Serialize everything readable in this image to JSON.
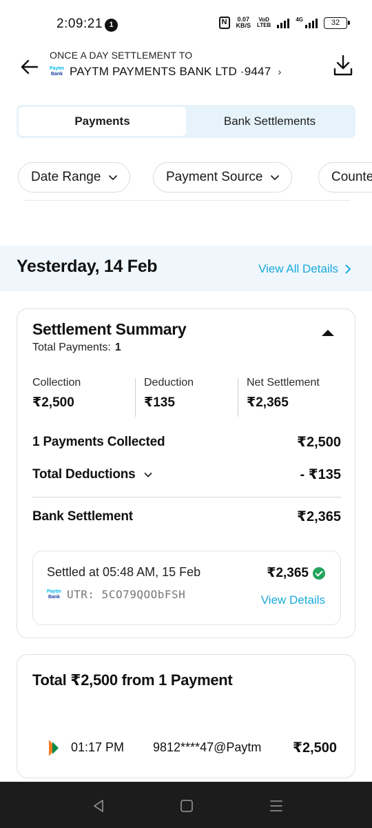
{
  "status_bar": {
    "time": "2:09:21",
    "notification_count": "1",
    "nfc": "N",
    "speed_value": "0.07",
    "speed_unit": "KB/S",
    "volte_top": "VoD",
    "volte_bottom": "LTEB",
    "network": "4G",
    "battery": "32"
  },
  "header": {
    "caption": "ONCE A DAY SETTLEMENT TO",
    "bank_logo_top": "Paytm",
    "bank_logo_bottom": "Bank",
    "bank_name": "PAYTM PAYMENTS BANK LTD ·9447",
    "chevron": "›"
  },
  "tabs": [
    {
      "label": "Payments",
      "active": true
    },
    {
      "label": "Bank Settlements",
      "active": false
    }
  ],
  "filters": [
    {
      "label": "Date Range"
    },
    {
      "label": "Payment Source"
    },
    {
      "label": "Counte"
    }
  ],
  "date_section": {
    "title": "Yesterday, 14 Feb",
    "view_all_label": "View All Details",
    "view_all_chevron": "›"
  },
  "summary": {
    "title": "Settlement Summary",
    "total_payments_label": "Total Payments:",
    "total_payments_value": "1",
    "stats": [
      {
        "label": "Collection",
        "value": "₹2,500"
      },
      {
        "label": "Deduction",
        "value": "₹135"
      },
      {
        "label": "Net Settlement",
        "value": "₹2,365"
      }
    ],
    "rows": [
      {
        "label": "1 Payments Collected",
        "value": "₹2,500"
      },
      {
        "label": "Total Deductions",
        "value": "- ₹135"
      },
      {
        "label": "Bank Settlement",
        "value": "₹2,365"
      }
    ],
    "settled": {
      "settled_at": "Settled at 05:48 AM, 15 Feb",
      "utr": "UTR: 5CO79QOObFSH",
      "amount": "₹2,365",
      "view_details_label": "View Details"
    }
  },
  "payments": {
    "title": "Total ₹2,500 from 1 Payment",
    "items": [
      {
        "time": "01:17 PM",
        "vpa": "9812****47@Paytm",
        "amount": "₹2,500"
      }
    ]
  },
  "colors": {
    "accent": "#1aa9dc",
    "tab_bg": "#e6f3fb",
    "date_band_bg": "#f0f7fc",
    "success": "#22a45d",
    "navbar": "#1c1c1c"
  }
}
